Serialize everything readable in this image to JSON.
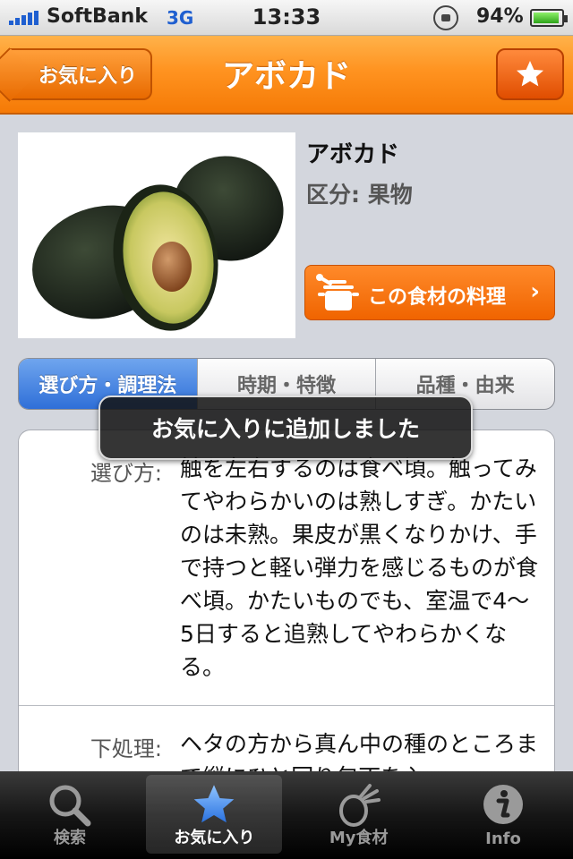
{
  "status_bar": {
    "carrier": "SoftBank",
    "network": "3G",
    "time": "13:33",
    "battery": "94%",
    "battery_level": 0.94
  },
  "nav": {
    "back_label": "お気に入り",
    "title": "アボカド",
    "star_icon": "star-icon"
  },
  "food": {
    "name": "アボカド",
    "category": "区分: 果物",
    "recipe_button": "この食材の料理",
    "recipe_chevron": "›"
  },
  "segments": [
    {
      "label": "選び方・調理法",
      "active": true
    },
    {
      "label": "時期・特徴",
      "active": false
    },
    {
      "label": "品種・由来",
      "active": false
    }
  ],
  "details": [
    {
      "label": "選び方:",
      "text": "触を左右するのは食べ頃。触ってみてやわらかいのは熟しすぎ。かたいのは未熟。果皮が黒くなりかけ、手で持つと軽い弾力を感じるものが食べ頃。かたいものでも、室温で4〜5日すると追熟してやわらかくなる。"
    },
    {
      "label": "下処理:",
      "text": "ヘタの方から真ん中の種のところまで縦にひと回り包丁を入"
    }
  ],
  "toast": "お気に入りに追加しました",
  "tabs": [
    {
      "label": "検索",
      "icon": "magnifier-icon",
      "active": false
    },
    {
      "label": "お気に入り",
      "icon": "star-icon",
      "active": true
    },
    {
      "label": "My食材",
      "icon": "vegetable-icon",
      "active": false
    },
    {
      "label": "Info",
      "icon": "info-icon",
      "active": false
    }
  ],
  "colors": {
    "nav_orange": "#ff9320",
    "segment_blue": "#2f6fd8",
    "recipe_orange": "#f06400",
    "tab_active_star": "#3b8af0"
  }
}
